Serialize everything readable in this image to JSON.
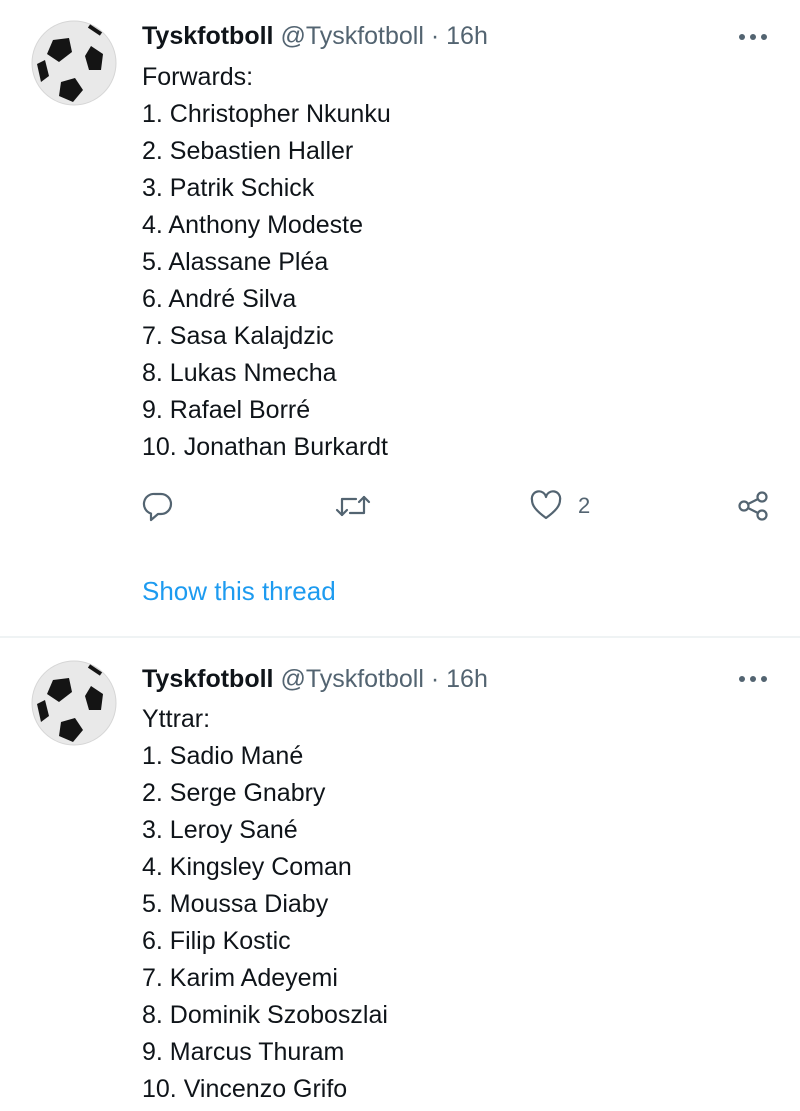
{
  "colors": {
    "text": "#0f1419",
    "secondary": "#536471",
    "link": "#1d9bf0",
    "divider": "#eff3f4"
  },
  "tweets": [
    {
      "avatar_icon": "soccer-ball-icon",
      "author_name": "Tyskfotboll",
      "author_handle": "@Tyskfotboll",
      "separator": "·",
      "time": "16h",
      "lines": [
        "Forwards:",
        "1. Christopher Nkunku",
        "2. Sebastien Haller",
        "3. Patrik Schick",
        "4. Anthony Modeste",
        "5. Alassane Pléa",
        "6. André Silva",
        "7. Sasa Kalajdzic",
        "8. Lukas Nmecha",
        "9. Rafael Borré",
        "10. Jonathan Burkardt"
      ],
      "like_count": "2",
      "show_thread": "Show this thread"
    },
    {
      "avatar_icon": "soccer-ball-icon",
      "author_name": "Tyskfotboll",
      "author_handle": "@Tyskfotboll",
      "separator": "·",
      "time": "16h",
      "lines": [
        "Yttrar:",
        "1. Sadio Mané",
        "2. Serge Gnabry",
        "3. Leroy Sané",
        "4. Kingsley Coman",
        "5. Moussa Diaby",
        "6. Filip Kostic",
        "7. Karim Adeyemi",
        "8. Dominik Szoboszlai",
        "9. Marcus Thuram",
        "10. Vincenzo Grifo"
      ]
    }
  ]
}
